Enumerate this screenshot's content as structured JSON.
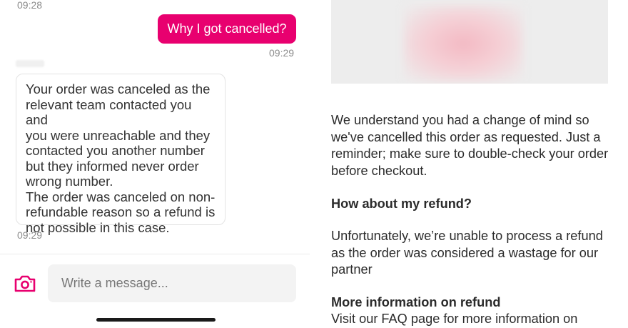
{
  "chat": {
    "timestamp_top": "09:28",
    "outgoing": {
      "text": "Why I got cancelled?",
      "time": "09:29"
    },
    "incoming": {
      "text": "Your order was canceled as the\nrelevant team contacted you and\nyou were unreachable  and they\ncontacted you another number\nbut they informed never order\nwrong number.\nThe order was canceled on non-\nrefundable reason so a refund is\nnot possible in this case.",
      "time": "09:29"
    },
    "composer": {
      "placeholder": "Write a message...",
      "camera_icon": "camera-icon"
    },
    "accent_color": "#e8006f"
  },
  "article": {
    "intro": "We understand you had a change of mind so we've cancelled this order as requested. Just a reminder; make sure to double-check your order before checkout.",
    "refund_heading": "How about my refund?",
    "refund_text": "Unfortunately, we’re unable to process a refund as the order was considered a wastage for our partner",
    "more_heading": "More information on refund",
    "more_text": "Visit our FAQ page for more information on"
  }
}
